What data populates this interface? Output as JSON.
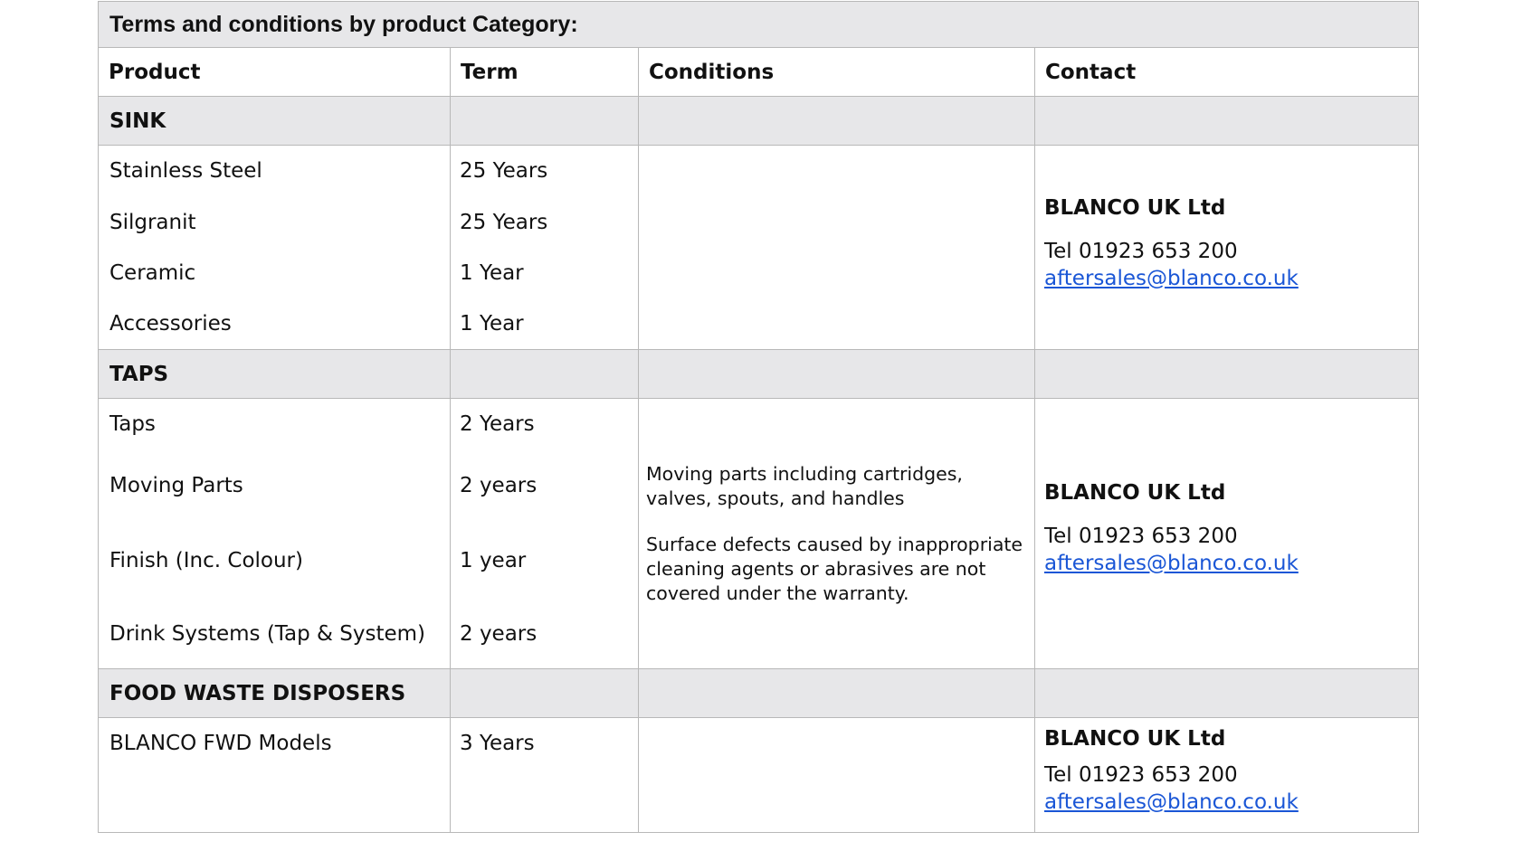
{
  "title": "Terms and conditions by product Category:",
  "headers": {
    "product": "Product",
    "term": "Term",
    "conditions": "Conditions",
    "contact": "Contact"
  },
  "sink": {
    "category": "SINK",
    "items": [
      {
        "product": "Stainless Steel",
        "term": "25 Years"
      },
      {
        "product": "Silgranit",
        "term": "25 Years"
      },
      {
        "product": "Ceramic",
        "term": "1 Year"
      },
      {
        "product": "Accessories",
        "term": "1 Year"
      }
    ],
    "contact": {
      "company": "BLANCO UK Ltd",
      "tel": "Tel  01923 653 200",
      "email": "aftersales@blanco.co.uk"
    }
  },
  "taps": {
    "category": "TAPS",
    "items": [
      {
        "product": "Taps",
        "term": "2 Years"
      },
      {
        "product": "Moving Parts",
        "term": "2 years"
      },
      {
        "product": "Finish (Inc. Colour)",
        "term": "1 year"
      },
      {
        "product": "Drink Systems (Tap & System)",
        "term": "2 years"
      }
    ],
    "conditions": [
      "Moving parts including cartridges, valves, spouts, and handles",
      "Surface defects caused by inappropriate cleaning agents or abrasives are not covered under the warranty."
    ],
    "contact": {
      "company": "BLANCO UK Ltd",
      "tel": "Tel  01923 653 200",
      "email": "aftersales@blanco.co.uk"
    }
  },
  "fwd": {
    "category": "FOOD WASTE DISPOSERS",
    "items": [
      {
        "product": "BLANCO FWD Models",
        "term": "3 Years"
      }
    ],
    "contact": {
      "company": "BLANCO UK Ltd",
      "tel": "Tel  01923 653 200",
      "email": "aftersales@blanco.co.uk"
    }
  }
}
